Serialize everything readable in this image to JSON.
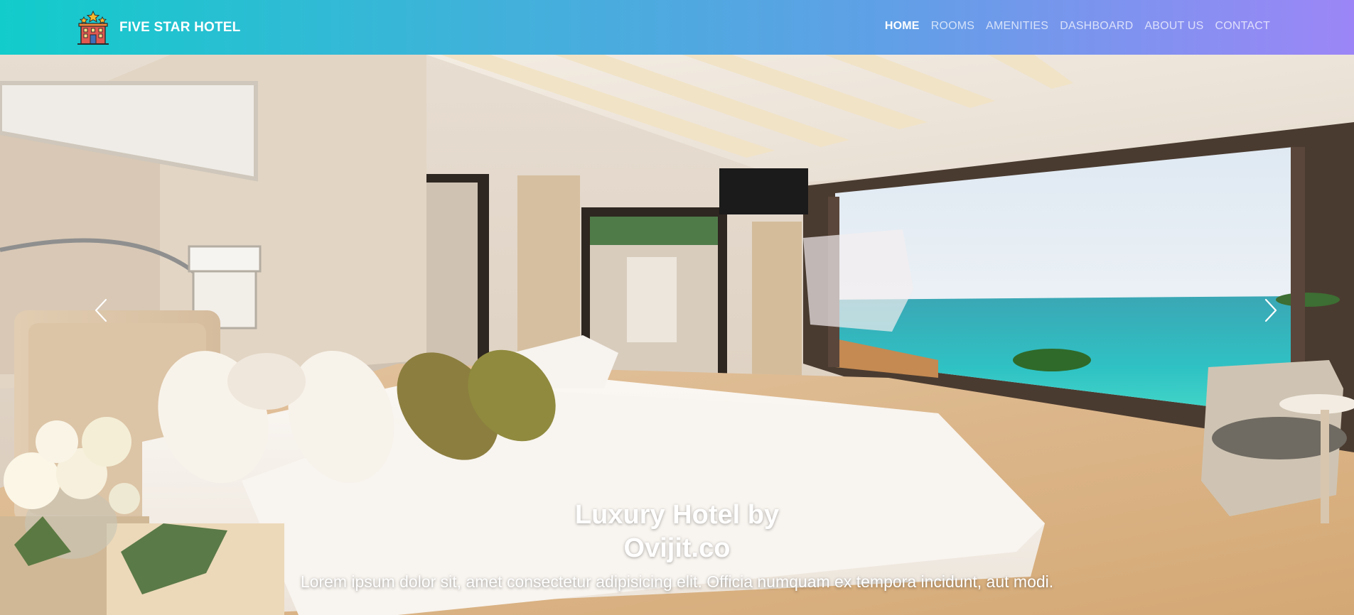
{
  "brand": {
    "name": "FIVE STAR HOTEL",
    "logo_icon": "hotel-building-stars-icon"
  },
  "nav": {
    "items": [
      {
        "label": "HOME",
        "active": true
      },
      {
        "label": "ROOMS",
        "active": false
      },
      {
        "label": "AMENITIES",
        "active": false
      },
      {
        "label": "DASHBOARD",
        "active": false
      },
      {
        "label": "ABOUT US",
        "active": false
      },
      {
        "label": "CONTACT",
        "active": false
      }
    ]
  },
  "hero": {
    "image_description": "luxury bedroom with sea view",
    "prev_icon": "chevron-left-icon",
    "next_icon": "chevron-right-icon",
    "caption": {
      "title": "Luxury Hotel by Ovijit.co",
      "text": "Lorem ipsum dolor sit, amet consectetur adipisicing elit. Officia numquam ex tempora incidunt, aut modi."
    }
  },
  "colors": {
    "navbar_gradient_start": "#12cccb",
    "navbar_gradient_end": "#9c86f7",
    "nav_active": "#ffffff",
    "nav_inactive": "rgba(255,255,255,0.72)"
  }
}
